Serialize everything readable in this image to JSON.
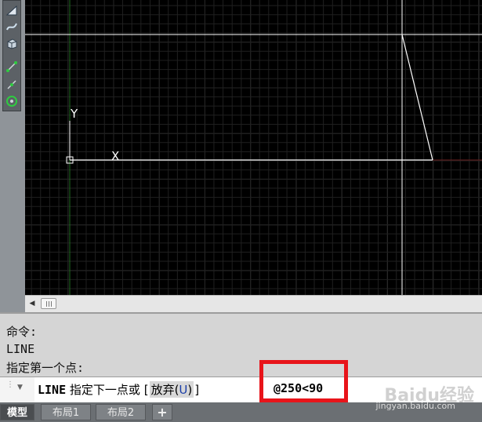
{
  "toolbar": {
    "tools": [
      {
        "icon": "wedge-icon"
      },
      {
        "icon": "surface-icon"
      },
      {
        "icon": "box-icon"
      },
      {
        "icon": "polyline-icon"
      },
      {
        "icon": "line-icon"
      },
      {
        "icon": "donut-icon"
      }
    ]
  },
  "canvas": {
    "background": "#000000",
    "ucs": {
      "x_label": "X",
      "y_label": "Y"
    }
  },
  "command_history": [
    "命令:",
    "LINE",
    "指定第一个点:"
  ],
  "command_line": {
    "command": "LINE",
    "prompt": "指定下一点或",
    "bracket_open": "[",
    "option_label": "放弃(",
    "option_key": "U",
    "option_close": ")",
    "bracket_close": "]",
    "typed_input": "@250<90"
  },
  "tabs": {
    "items": [
      "模型",
      "布局1",
      "布局2"
    ],
    "active": "模型",
    "add_label": "+"
  },
  "watermark": {
    "logo_text": "Baidu经验",
    "url": "jingyan.baidu.com"
  },
  "colors": {
    "highlight_box": "#e8141a",
    "option_key": "#1a3ea8"
  }
}
